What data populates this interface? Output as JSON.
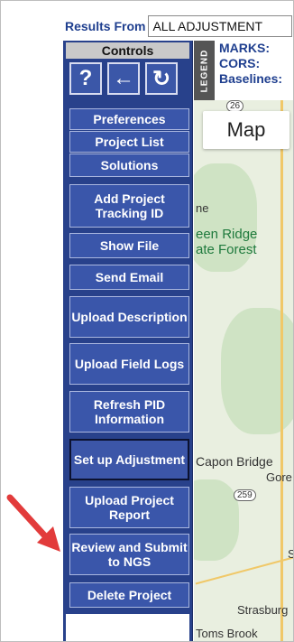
{
  "results_bar": {
    "label": "Results From",
    "selected": "ALL ADJUSTMENT"
  },
  "controls": {
    "header": "Controls",
    "icons": [
      {
        "name": "help-icon",
        "glyph": "?"
      },
      {
        "name": "back-arrow-icon",
        "glyph": "←"
      },
      {
        "name": "refresh-icon",
        "glyph": "↻"
      }
    ],
    "buttons": [
      {
        "label": "Preferences"
      },
      {
        "label": "Project List"
      },
      {
        "label": "Solutions"
      },
      {
        "label": "Add Project Tracking ID"
      },
      {
        "label": "Show File"
      },
      {
        "label": "Send Email"
      },
      {
        "label": "Upload Description"
      },
      {
        "label": "Upload Field Logs"
      },
      {
        "label": "Refresh PID Information"
      },
      {
        "label": "Set up Adjustment"
      },
      {
        "label": "Upload Project Report"
      },
      {
        "label": "Review and Submit to NGS"
      },
      {
        "label": "Delete Project"
      }
    ]
  },
  "legend": {
    "strip_label": "LEGEND",
    "items": [
      "MARKS:",
      "CORS:",
      "Baselines:"
    ]
  },
  "map": {
    "button": "Map",
    "places": [
      "ne",
      "een Ridge",
      "ate Forest",
      "Capon Bridge",
      "Gore",
      "S",
      "Strasburg",
      "Toms Brook"
    ],
    "route_shields": [
      "26",
      "259"
    ]
  },
  "colors": {
    "panel": "#28418b",
    "button": "#3a56aa",
    "accent_text": "#1f3f8f",
    "arrow": "#e23b3b"
  }
}
